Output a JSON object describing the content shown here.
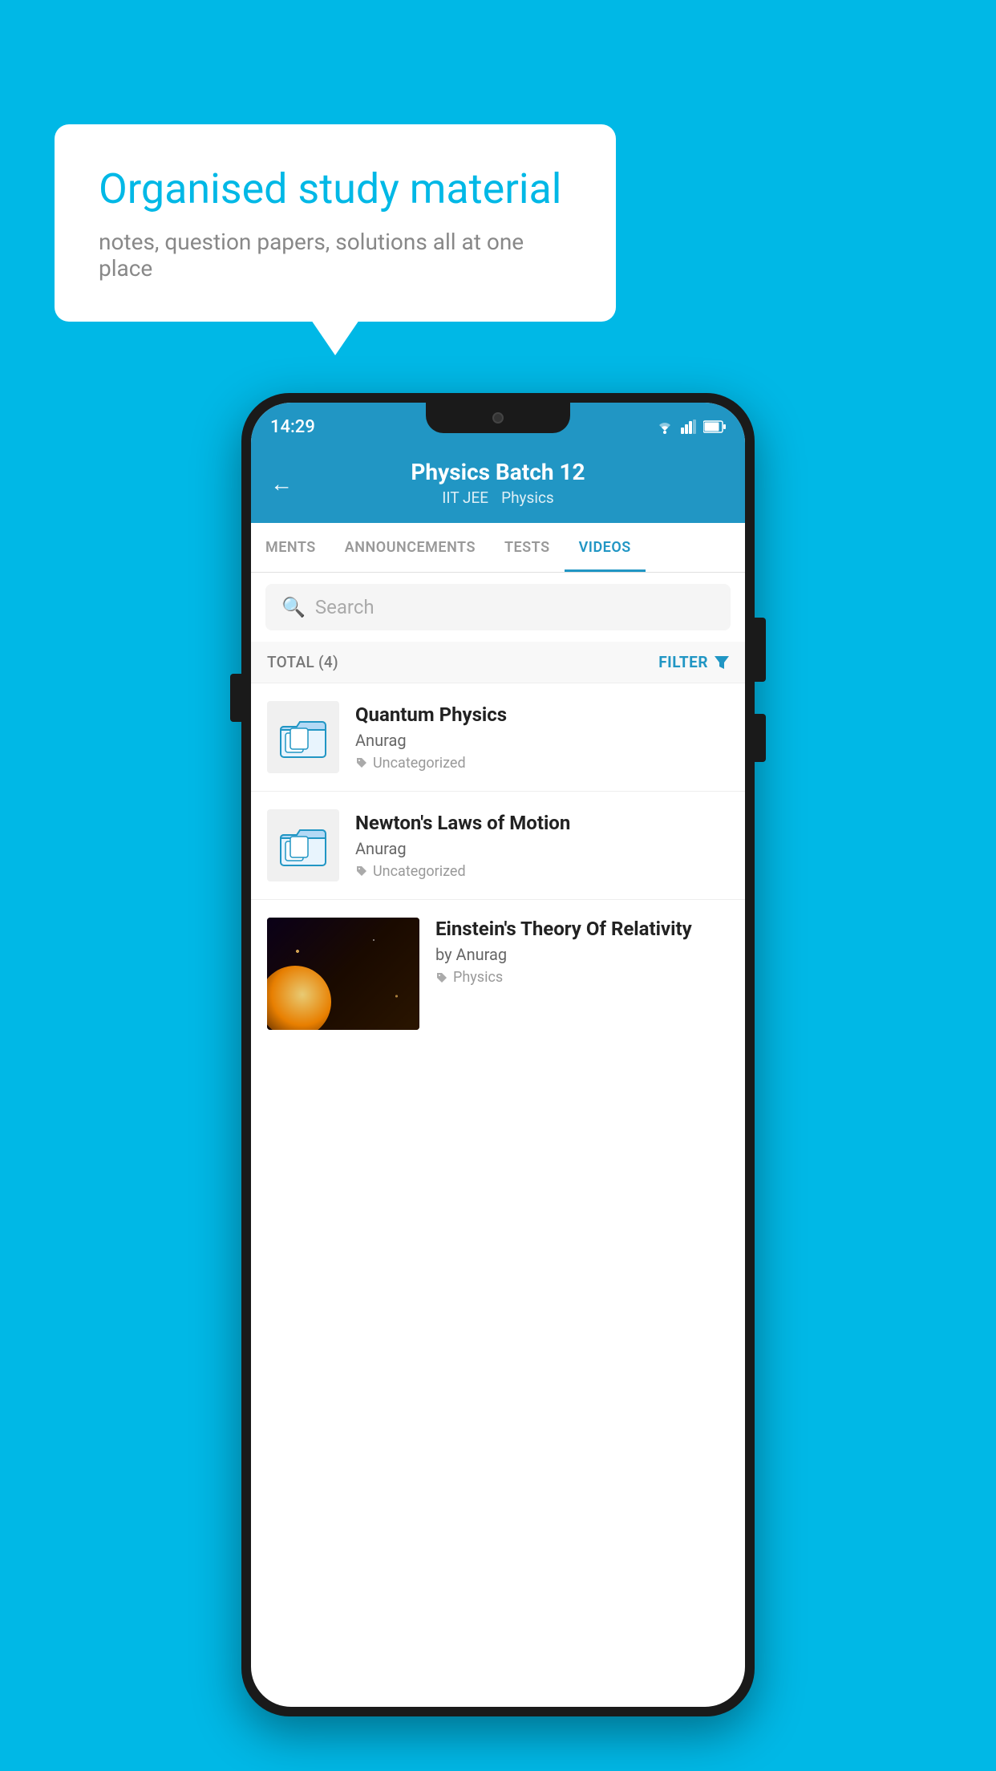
{
  "background": {
    "color": "#00b8e6"
  },
  "speech_bubble": {
    "title": "Organised study material",
    "subtitle": "notes, question papers, solutions all at one place"
  },
  "phone": {
    "status_bar": {
      "time": "14:29"
    },
    "header": {
      "title": "Physics Batch 12",
      "subtitle1": "IIT JEE",
      "subtitle2": "Physics",
      "back_label": "←"
    },
    "tabs": [
      {
        "label": "MENTS",
        "active": false
      },
      {
        "label": "ANNOUNCEMENTS",
        "active": false
      },
      {
        "label": "TESTS",
        "active": false
      },
      {
        "label": "VIDEOS",
        "active": true
      }
    ],
    "search": {
      "placeholder": "Search"
    },
    "filter_row": {
      "total_label": "TOTAL (4)",
      "filter_label": "FILTER"
    },
    "videos": [
      {
        "title": "Quantum Physics",
        "author": "Anurag",
        "tag": "Uncategorized",
        "has_thumbnail": false
      },
      {
        "title": "Newton's Laws of Motion",
        "author": "Anurag",
        "tag": "Uncategorized",
        "has_thumbnail": false
      },
      {
        "title": "Einstein's Theory Of Relativity",
        "author": "by Anurag",
        "tag": "Physics",
        "has_thumbnail": true
      }
    ]
  }
}
